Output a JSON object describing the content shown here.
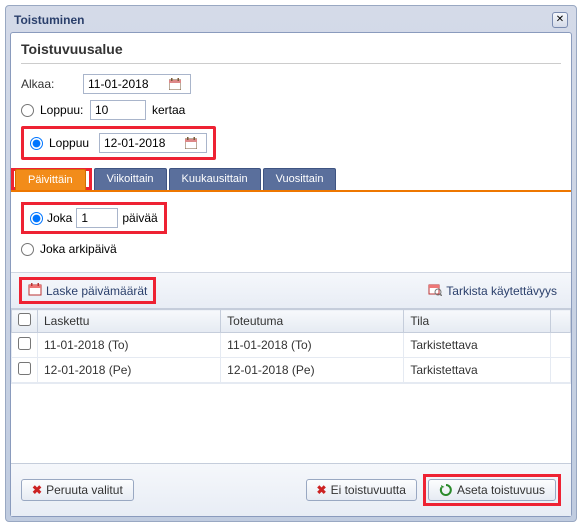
{
  "dialog": {
    "title": "Toistuminen"
  },
  "range": {
    "section_title": "Toistuvuusalue",
    "starts_label": "Alkaa:",
    "starts_value": "11-01-2018",
    "ends_count_label": "Loppuu:",
    "ends_count_value": "10",
    "ends_count_suffix": "kertaa",
    "ends_date_label": "Loppuu",
    "ends_date_value": "12-01-2018",
    "ends_mode": "date"
  },
  "tabs": {
    "daily": "Päivittäin",
    "weekly": "Viikoittain",
    "monthly": "Kuukausittain",
    "yearly": "Vuosittain",
    "active": "daily"
  },
  "daily": {
    "every_label": "Joka",
    "every_value": "1",
    "every_suffix": "päivää",
    "weekday_label": "Joka arkipäivä",
    "mode": "every"
  },
  "toolbar": {
    "calc_label": "Laske päivämäärät",
    "check_label": "Tarkista käytettävyys"
  },
  "table": {
    "col_check": "",
    "col_calculated": "Laskettu",
    "col_actual": "Toteutuma",
    "col_status": "Tila",
    "rows": [
      {
        "calculated": "11-01-2018 (To)",
        "actual": "11-01-2018 (To)",
        "status": "Tarkistettava"
      },
      {
        "calculated": "12-01-2018 (Pe)",
        "actual": "12-01-2018 (Pe)",
        "status": "Tarkistettava"
      }
    ]
  },
  "footer": {
    "cancel_selected": "Peruuta valitut",
    "no_recurrence": "Ei toistuvuutta",
    "set_recurrence": "Aseta toistuvuus"
  }
}
